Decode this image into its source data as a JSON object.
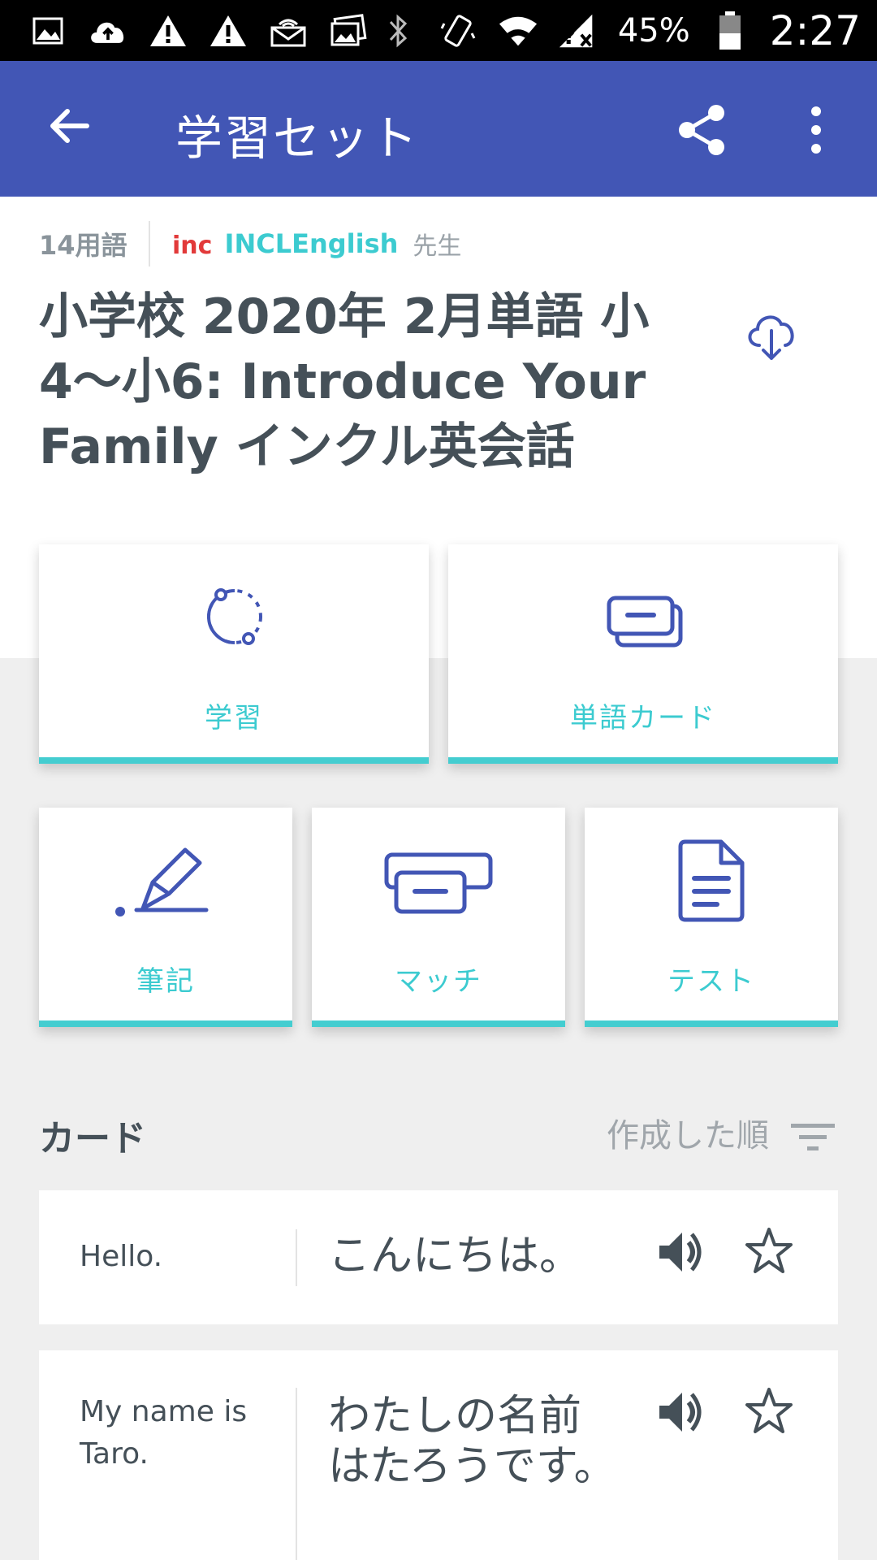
{
  "status_bar": {
    "battery_pct": "45%",
    "time": "2:27",
    "left_icons": [
      "image-icon",
      "cloud-upload-icon",
      "warning-icon",
      "warning-icon",
      "mail-icon",
      "photos-icon"
    ],
    "right_icons": [
      "bluetooth-icon",
      "vibrate-icon",
      "wifi-icon",
      "no-signal-icon",
      "battery-icon"
    ]
  },
  "app_bar": {
    "title": "学習セット"
  },
  "meta": {
    "term_count": "14用語",
    "author": "INCLEnglish",
    "author_role": "先生",
    "logo_text": "incl"
  },
  "set_title": "小学校 2020年 2月単語 小4〜小6: Introduce Your Family インクル英会話",
  "modes": {
    "learn": "学習",
    "flashcards": "単語カード",
    "write": "筆記",
    "match": "マッチ",
    "test": "テスト"
  },
  "cards_section": {
    "heading": "カード",
    "sort_label": "作成した順"
  },
  "terms": [
    {
      "term": "Hello.",
      "definition": "こんにちは。"
    },
    {
      "term": "My name is Taro.",
      "definition": "わたしの名前はたろうです。"
    }
  ],
  "colors": {
    "app_bar": "#4256b5",
    "accent": "#44cdd0",
    "icon": "#4256b5",
    "text": "#455058"
  }
}
